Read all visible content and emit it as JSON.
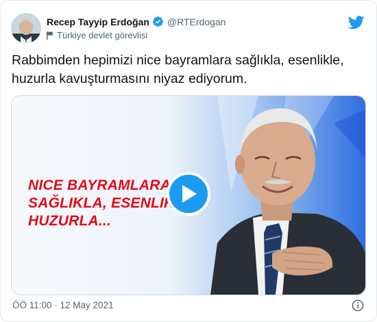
{
  "author": {
    "display_name": "Recep Tayyip Erdoğan",
    "handle": "@RTErdogan",
    "verified": true,
    "label": "Türkiye devlet görevlisi",
    "label_icon": "flag-icon",
    "avatar_icon": "avatar"
  },
  "tweet": {
    "text": "Rabbimden hepimizi nice bayramlara sağlıkla, esenlikle, huzurla kavuşturmasını niyaz ediyorum.",
    "media": {
      "overlay_lines": [
        "NICE BAYRAMLARA",
        "SAĞLIKLA, ESENLIKLE",
        "HUZURLA..."
      ],
      "overlay_color": "#e30a17",
      "play_icon": "play-icon",
      "accent_color": "#1d9bf0"
    },
    "timestamp": "ÖÖ 11:00 · 12 May 2021"
  },
  "icons": {
    "brand": "twitter-bird-icon",
    "info": "info-icon",
    "verified": "verified-badge-icon"
  },
  "colors": {
    "brand": "#1d9bf0",
    "text": "#0f1419",
    "muted": "#536471",
    "border": "#e1e8ed"
  }
}
